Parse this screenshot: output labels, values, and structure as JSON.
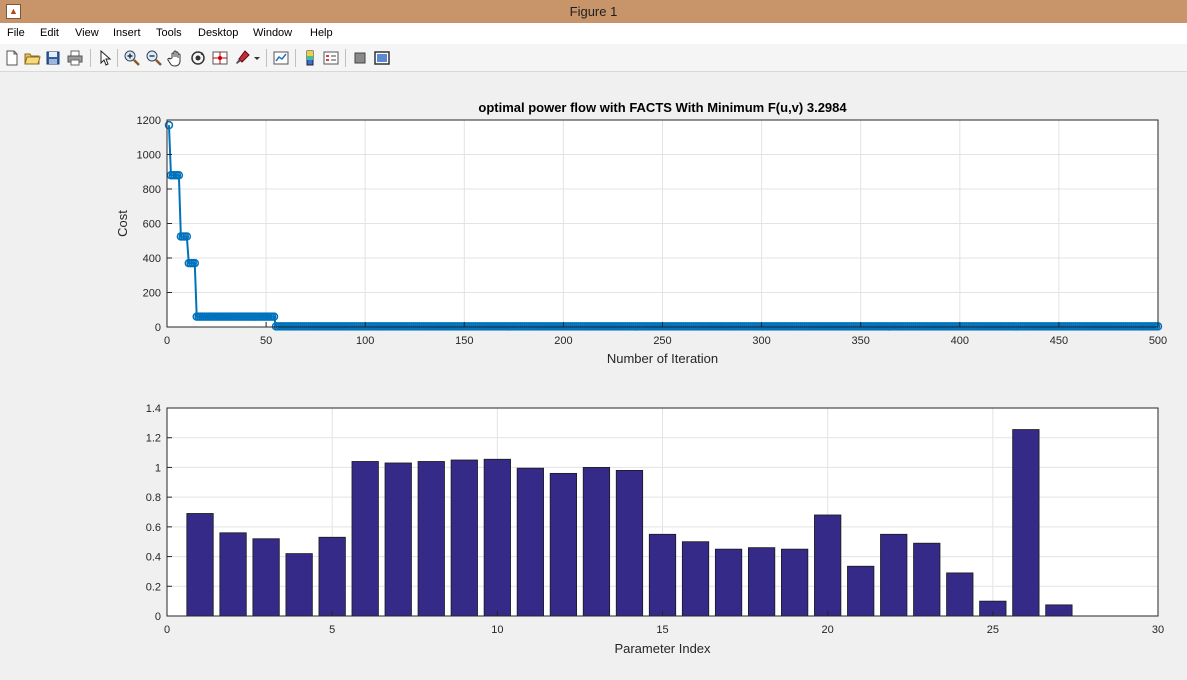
{
  "window": {
    "title": "Figure 1"
  },
  "menu": [
    "File",
    "Edit",
    "View",
    "Insert",
    "Tools",
    "Desktop",
    "Window",
    "Help"
  ],
  "toolbar": {
    "icons": [
      "new-figure-icon",
      "open-file-icon",
      "save-icon",
      "print-icon",
      "edit-plot-arrow-icon",
      "zoom-in-icon",
      "zoom-out-icon",
      "pan-icon",
      "rotate-3d-icon",
      "data-cursor-icon",
      "brush-icon",
      "brush-dropdown-icon",
      "link-plot-icon",
      "insert-colorbar-icon",
      "insert-legend-icon",
      "hide-plot-tools-icon",
      "show-plot-tools-icon"
    ]
  },
  "chart_data": [
    {
      "type": "line",
      "title": "optimal power flow with FACTS With Minimum F(u,v)  3.2984",
      "xlabel": "Number of Iteration",
      "ylabel": "Cost",
      "xlim": [
        0,
        500
      ],
      "ylim": [
        0,
        1200
      ],
      "xticks": [
        "0",
        "50",
        "100",
        "150",
        "200",
        "250",
        "300",
        "350",
        "400",
        "450",
        "500"
      ],
      "yticks": [
        "0",
        "200",
        "400",
        "600",
        "800",
        "1000",
        "1200"
      ],
      "grid": true,
      "color": "#0072bd",
      "marker": "o",
      "segments": [
        {
          "from": 1,
          "to": 1,
          "y": 1170
        },
        {
          "from": 2,
          "to": 6,
          "y": 880
        },
        {
          "from": 7,
          "to": 10,
          "y": 525
        },
        {
          "from": 11,
          "to": 14,
          "y": 370
        },
        {
          "from": 15,
          "to": 54,
          "y": 60
        },
        {
          "from": 55,
          "to": 500,
          "y": 3.2984
        }
      ]
    },
    {
      "type": "bar",
      "title": "",
      "xlabel": "Parameter Index",
      "ylabel": "",
      "xlim": [
        0,
        30
      ],
      "ylim": [
        0,
        1.4
      ],
      "xticks": [
        "0",
        "5",
        "10",
        "15",
        "20",
        "25",
        "30"
      ],
      "yticks": [
        "0",
        "0.2",
        "0.4",
        "0.6",
        "0.8",
        "1",
        "1.2",
        "1.4"
      ],
      "grid": true,
      "color": "#352a87",
      "categories": [
        1,
        2,
        3,
        4,
        5,
        6,
        7,
        8,
        9,
        10,
        11,
        12,
        13,
        14,
        15,
        16,
        17,
        18,
        19,
        20,
        21,
        22,
        23,
        24,
        25,
        26,
        27
      ],
      "values": [
        0.69,
        0.56,
        0.52,
        0.42,
        0.53,
        1.04,
        1.03,
        1.04,
        1.05,
        1.055,
        0.995,
        0.96,
        1.0,
        0.98,
        0.55,
        0.5,
        0.45,
        0.46,
        0.45,
        0.68,
        0.335,
        0.55,
        0.49,
        0.29,
        0.1,
        1.255,
        0.075
      ]
    }
  ]
}
